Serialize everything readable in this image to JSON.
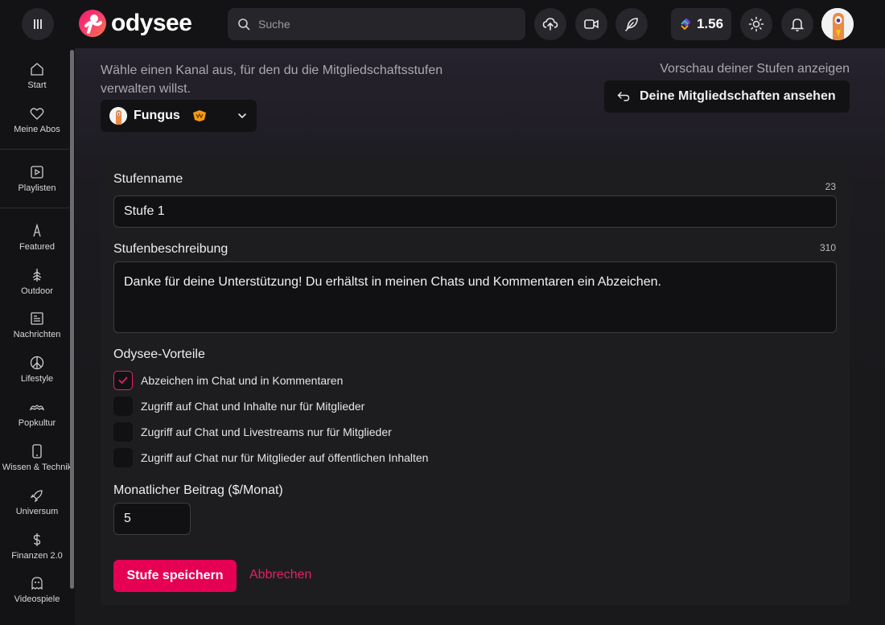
{
  "header": {
    "logo_text": "odysee",
    "search_placeholder": "Suche",
    "credits": "1.56"
  },
  "sidebar": {
    "items": [
      {
        "label": "Start",
        "icon": "home-icon"
      },
      {
        "label": "Meine Abos",
        "icon": "heart-icon"
      },
      {
        "label": "Playlisten",
        "icon": "playlist-icon"
      },
      {
        "label": "Featured",
        "icon": "featured-icon"
      },
      {
        "label": "Outdoor",
        "icon": "tree-icon"
      },
      {
        "label": "Nachrichten",
        "icon": "news-icon"
      },
      {
        "label": "Lifestyle",
        "icon": "peace-icon"
      },
      {
        "label": "Popkultur",
        "icon": "popculture-icon"
      },
      {
        "label": "Wissen & Technik",
        "icon": "phone-icon"
      },
      {
        "label": "Universum",
        "icon": "rocket-icon"
      },
      {
        "label": "Finanzen 2.0",
        "icon": "dollar-icon"
      },
      {
        "label": "Videospiele",
        "icon": "ghost-icon"
      }
    ]
  },
  "main": {
    "intro": "Wähle einen Kanal aus, für den du die Mitgliedschaftsstufen verwalten willst.",
    "preview_label": "Vorschau deiner Stufen anzeigen",
    "view_button": "Deine Mitgliedschaften ansehen",
    "channel_name": "Fungus",
    "form": {
      "tier_name_label": "Stufenname",
      "tier_name_counter": "23",
      "tier_name_value": "Stufe 1",
      "tier_desc_label": "Stufenbeschreibung",
      "tier_desc_counter": "310",
      "tier_desc_value": "Danke für deine Unterstützung! Du  erhältst in meinen Chats und Kommentaren ein Abzeichen.",
      "perks_label": "Odysee-Vorteile",
      "perks": [
        {
          "label": "Abzeichen im Chat und in Kommentaren",
          "checked": true
        },
        {
          "label": "Zugriff auf Chat und Inhalte nur für Mitglieder",
          "checked": false
        },
        {
          "label": "Zugriff auf Chat und Livestreams nur für Mitglieder",
          "checked": false
        },
        {
          "label": "Zugriff auf Chat nur für Mitglieder auf öffentlichen Inhalten",
          "checked": false
        }
      ],
      "price_label": "Monatlicher Beitrag ($/Monat)",
      "price_value": "5",
      "save_label": "Stufe speichern",
      "cancel_label": "Abbrechen"
    }
  },
  "colors": {
    "accent": "#e50054",
    "background": "#17171a",
    "card": "#1d1d20"
  }
}
